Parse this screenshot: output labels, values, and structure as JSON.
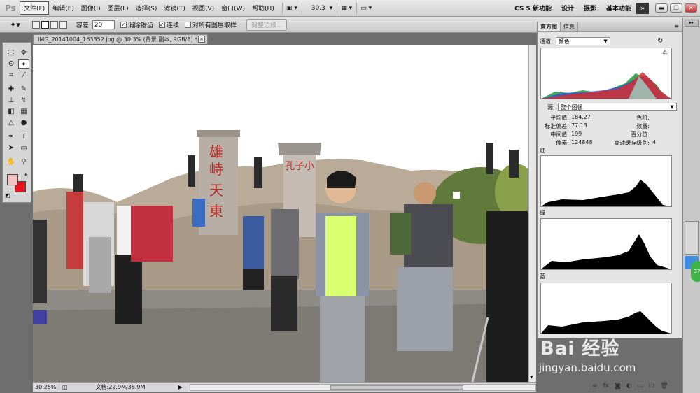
{
  "app": {
    "logo": "Ps",
    "menu": [
      "文件(F)",
      "编辑(E)",
      "图像(I)",
      "图层(L)",
      "选择(S)",
      "滤镜(T)",
      "视图(V)",
      "窗口(W)",
      "帮助(H)"
    ],
    "zoom_label": "30.3",
    "workspaces": [
      "CS 5 新功能",
      "设计",
      "摄影",
      "基本功能"
    ],
    "expand": "»"
  },
  "options": {
    "tolerance_label": "容差:",
    "tolerance_value": "20",
    "antialias_label": "消除锯齿",
    "contiguous_label": "连续",
    "sample_all_label": "对所有图层取样",
    "refine_edge_label": "调整边缘..."
  },
  "document": {
    "tab_title": "IMG_20141004_163352.jpg @ 30.3% (背景 副本, RGB/8) *",
    "close": "×"
  },
  "status": {
    "zoom": "30.25%",
    "doc_size": "文档:22.9M/38.9M"
  },
  "histogram": {
    "tabs": [
      "直方图",
      "信息"
    ],
    "channel_label": "通道:",
    "channel_value": "颜色",
    "source_label": "源:",
    "source_value": "整个图像",
    "stats_left": [
      {
        "label": "平均值:",
        "value": "184.27"
      },
      {
        "label": "标准偏差:",
        "value": "77.13"
      },
      {
        "label": "中间值:",
        "value": "199"
      },
      {
        "label": "像素:",
        "value": "124848"
      }
    ],
    "stats_right": [
      {
        "label": "色阶:",
        "value": ""
      },
      {
        "label": "数量:",
        "value": ""
      },
      {
        "label": "百分位:",
        "value": ""
      },
      {
        "label": "高速缓存级别:",
        "value": "4"
      }
    ],
    "channels": [
      "红",
      "绿",
      "蓝"
    ]
  },
  "watermark": {
    "brand": "Bai 经验",
    "url": "jingyan.baidu.com"
  },
  "bubble": "37",
  "colors": {
    "foreground": "#f4c4c4",
    "background": "#e8141c"
  }
}
